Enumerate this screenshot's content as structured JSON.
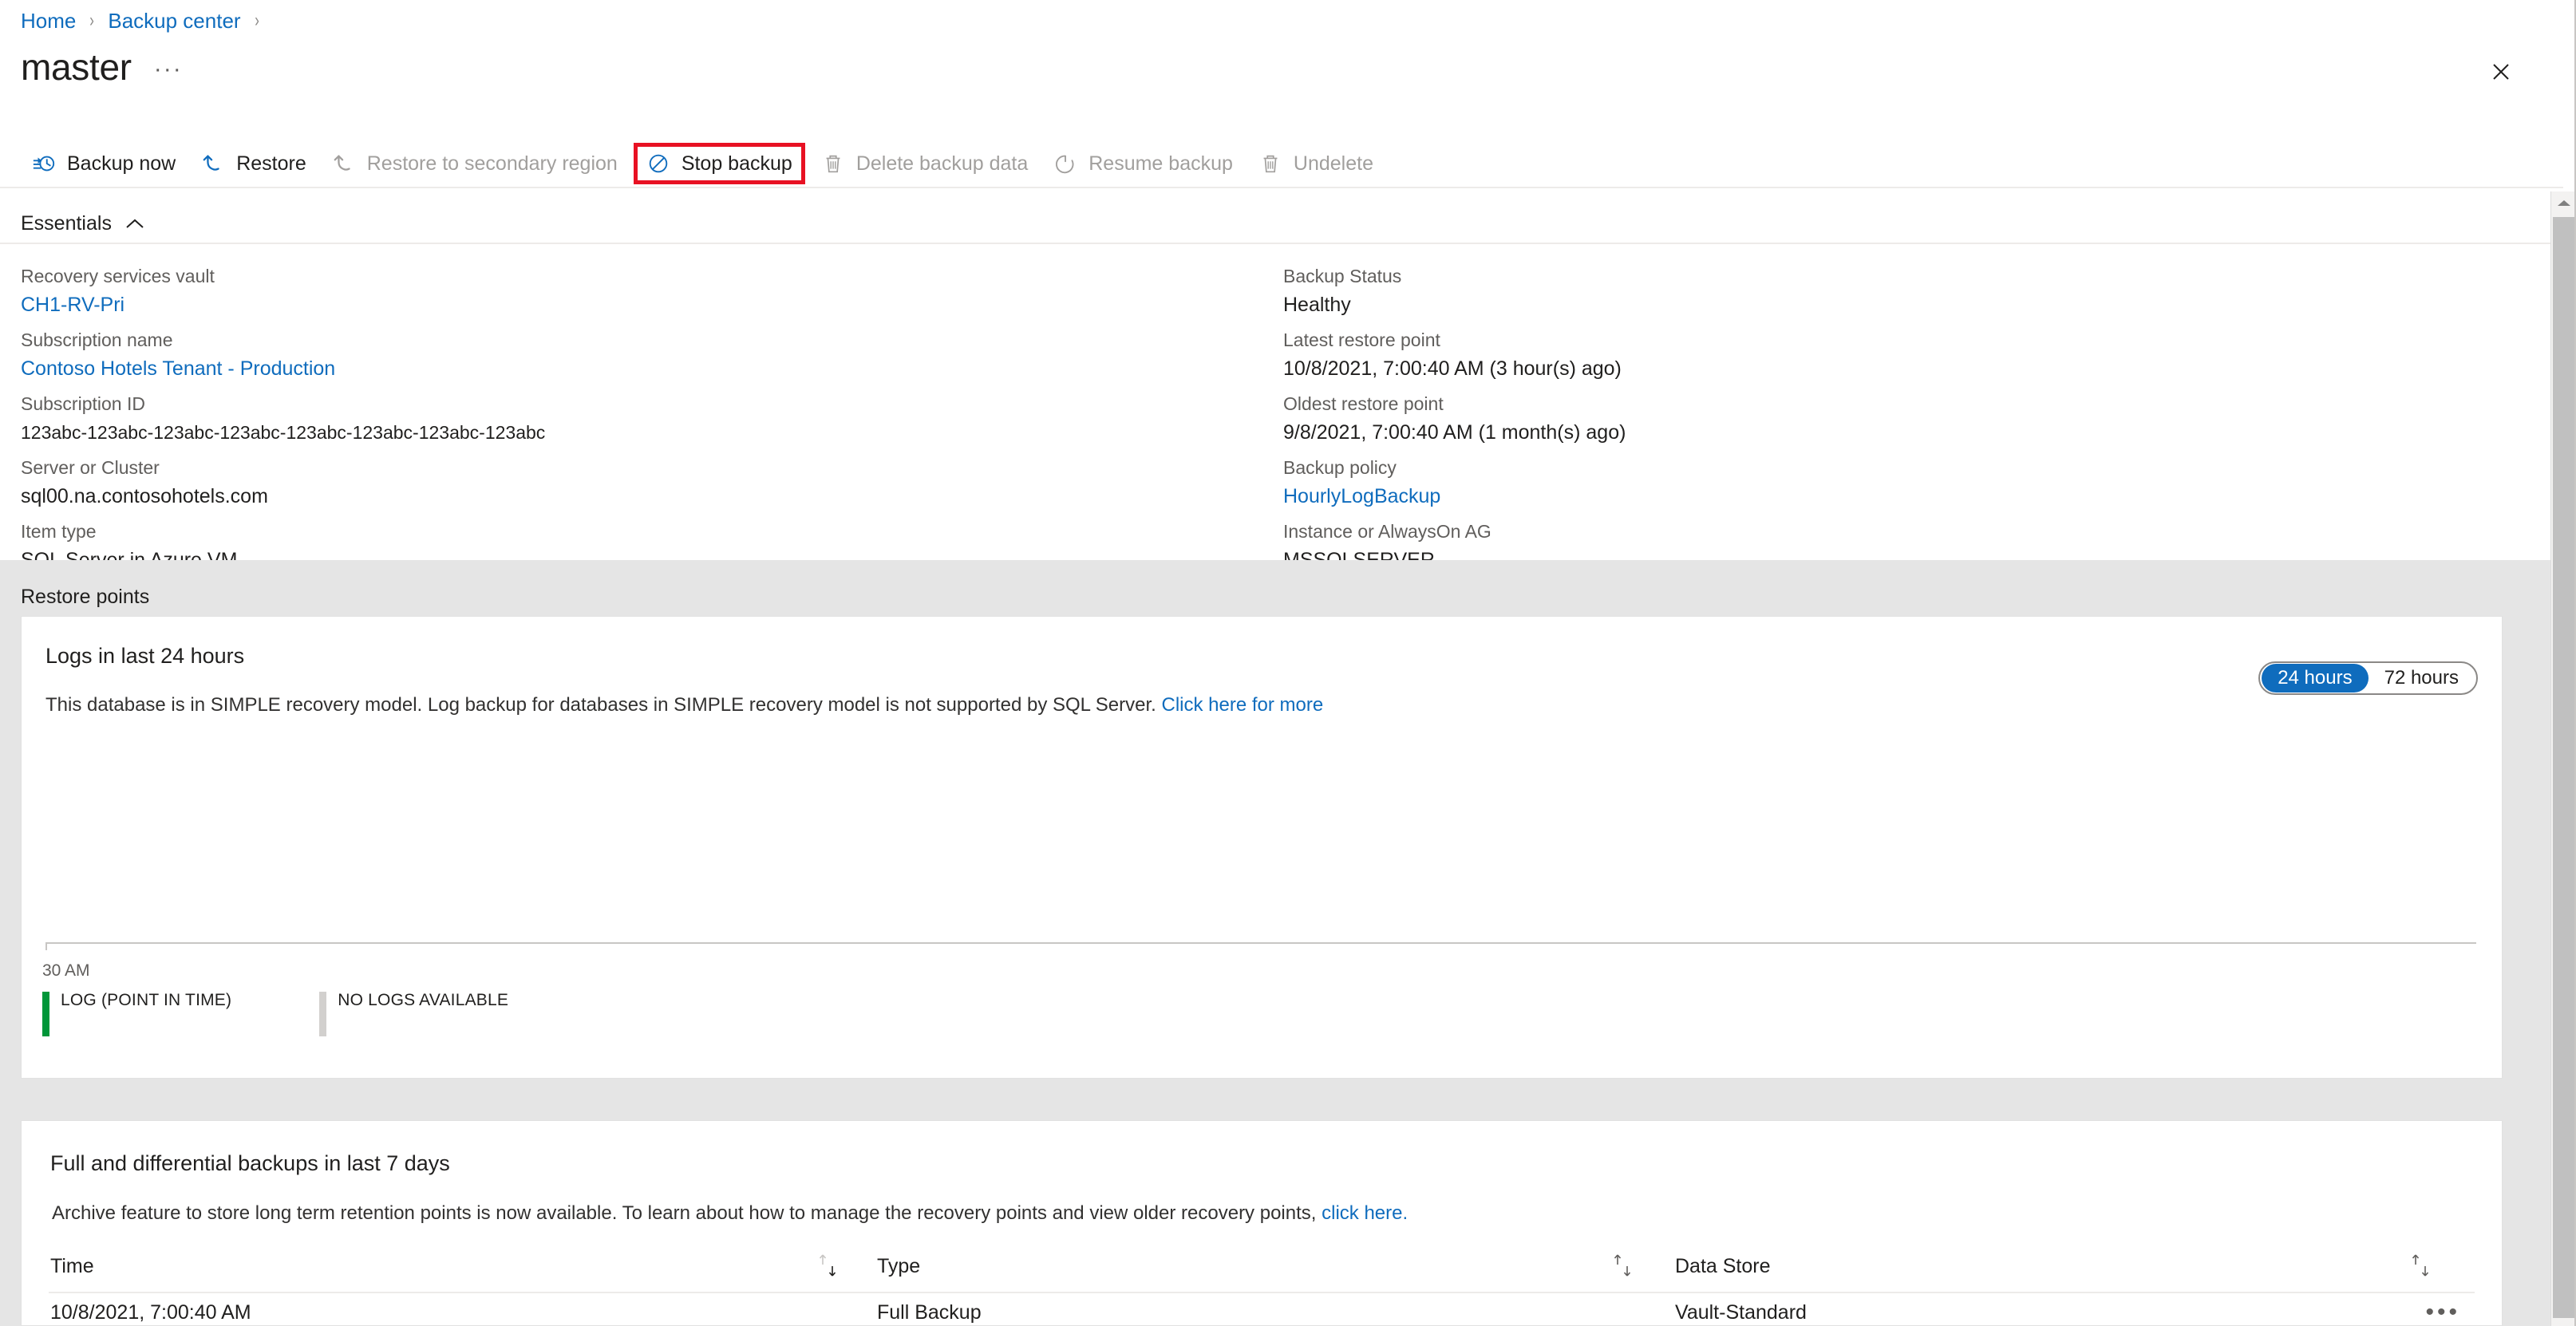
{
  "breadcrumb": {
    "items": [
      {
        "label": "Home",
        "type": "link"
      },
      {
        "label": "Backup center",
        "type": "link"
      }
    ],
    "separator": "›"
  },
  "header": {
    "title": "master",
    "ellipsis": "···",
    "close_label": "close-icon"
  },
  "toolbar": {
    "items": [
      {
        "label": "Backup now",
        "icon": "backup-now-icon",
        "state": "enabled"
      },
      {
        "label": "Restore",
        "icon": "restore-icon",
        "state": "enabled"
      },
      {
        "label": "Restore to secondary region",
        "icon": "restore-secondary-icon",
        "state": "disabled"
      },
      {
        "label": "Stop backup",
        "icon": "stop-backup-icon",
        "state": "enabled",
        "highlighted": true
      },
      {
        "label": "Delete backup data",
        "icon": "trash-icon",
        "state": "disabled"
      },
      {
        "label": "Resume backup",
        "icon": "resume-icon",
        "state": "disabled"
      },
      {
        "label": "Undelete",
        "icon": "trash-icon",
        "state": "disabled"
      }
    ],
    "highlight_color": "#e81123"
  },
  "essentials": {
    "header_label": "Essentials",
    "chevron": "chevron-up-icon",
    "left": [
      {
        "label": "Recovery services vault",
        "value": "CH1-RV-Pri",
        "is_link": true
      },
      {
        "label": "Subscription name",
        "value": "Contoso Hotels Tenant - Production",
        "is_link": true
      },
      {
        "label": "Subscription ID",
        "value": "123abc-123abc-123abc-123abc-123abc-123abc-123abc-123abc",
        "is_link": false
      },
      {
        "label": "Server or Cluster",
        "value": "sql00.na.contosohotels.com",
        "is_link": false
      },
      {
        "label": "Item type",
        "value": "SQL Server in Azure VM",
        "is_link": false
      }
    ],
    "right": [
      {
        "label": "Backup Status",
        "value": "Healthy",
        "is_link": false
      },
      {
        "label": "Latest restore point",
        "value": "10/8/2021, 7:00:40 AM (3 hour(s) ago)",
        "is_link": false
      },
      {
        "label": "Oldest restore point",
        "value": "9/8/2021, 7:00:40 AM (1 month(s) ago)",
        "is_link": false
      },
      {
        "label": "Backup policy",
        "value": "HourlyLogBackup",
        "is_link": true
      },
      {
        "label": "Instance or AlwaysOn AG",
        "value": "MSSQLSERVER",
        "is_link": false
      }
    ]
  },
  "restore_points_section": {
    "label": "Restore points"
  },
  "logs_card": {
    "title": "Logs in last 24 hours",
    "note_text": "This database is in SIMPLE recovery model. Log backup for databases in SIMPLE recovery model is not supported by SQL Server. ",
    "note_link": "Click here for more",
    "range_toggle": {
      "options": [
        "24 hours",
        "72 hours"
      ],
      "selected": "24 hours",
      "active_color": "#0f6cbd"
    }
  },
  "chart_data": {
    "type": "bar",
    "title": "Logs in last 24 hours",
    "categories": [],
    "values": [],
    "xlabel": "",
    "ylabel": "",
    "x_tick_labels": [
      "30 AM"
    ],
    "grid": false,
    "legend_position": "bottom",
    "legend": [
      {
        "name": "LOG (POINT IN TIME)",
        "color": "#009639"
      },
      {
        "name": "NO LOGS AVAILABLE",
        "color": "#d2d0ce"
      }
    ]
  },
  "full_card": {
    "title": "Full and differential backups in last 7 days",
    "note_text": "Archive feature to store long term retention points is now available. To learn about how to manage the recovery points and view older recovery points, ",
    "note_link": "click here.",
    "columns": [
      {
        "label": "Time",
        "sortable": true
      },
      {
        "label": "Type",
        "sortable": true
      },
      {
        "label": "Data Store",
        "sortable": true
      }
    ],
    "rows": [
      {
        "time": "10/8/2021, 7:00:40 AM",
        "type": "Full Backup",
        "data_store": "Vault-Standard"
      }
    ],
    "row_menu": "•••"
  },
  "scrollbar": {
    "up_arrow": "scroll-up-icon"
  }
}
